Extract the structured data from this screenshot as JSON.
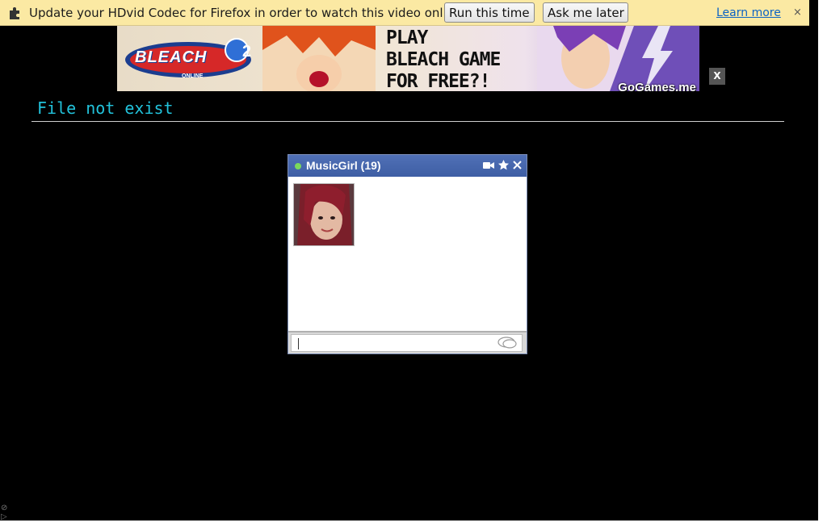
{
  "notification": {
    "message": "Update your HDvid Codec for Firefox in order to watch this video online.",
    "run_label": "Run this time",
    "later_label": "Ask me later",
    "learn_label": "Learn more",
    "close_label": "×"
  },
  "ad": {
    "logo_text": "BLEACH",
    "logo_sub": "ONLINE",
    "cta_lines": [
      "PLAY",
      "BLEACH GAME",
      "FOR FREE?!"
    ],
    "brand": "GoGames.me",
    "close_label": "X"
  },
  "page": {
    "title": "File not exist"
  },
  "chat": {
    "name": "MusicGirl (19)",
    "status_color": "#7bd95b",
    "icons": [
      "video-camera-icon",
      "star-icon",
      "close-icon",
      "speech-bubble-icon"
    ]
  }
}
